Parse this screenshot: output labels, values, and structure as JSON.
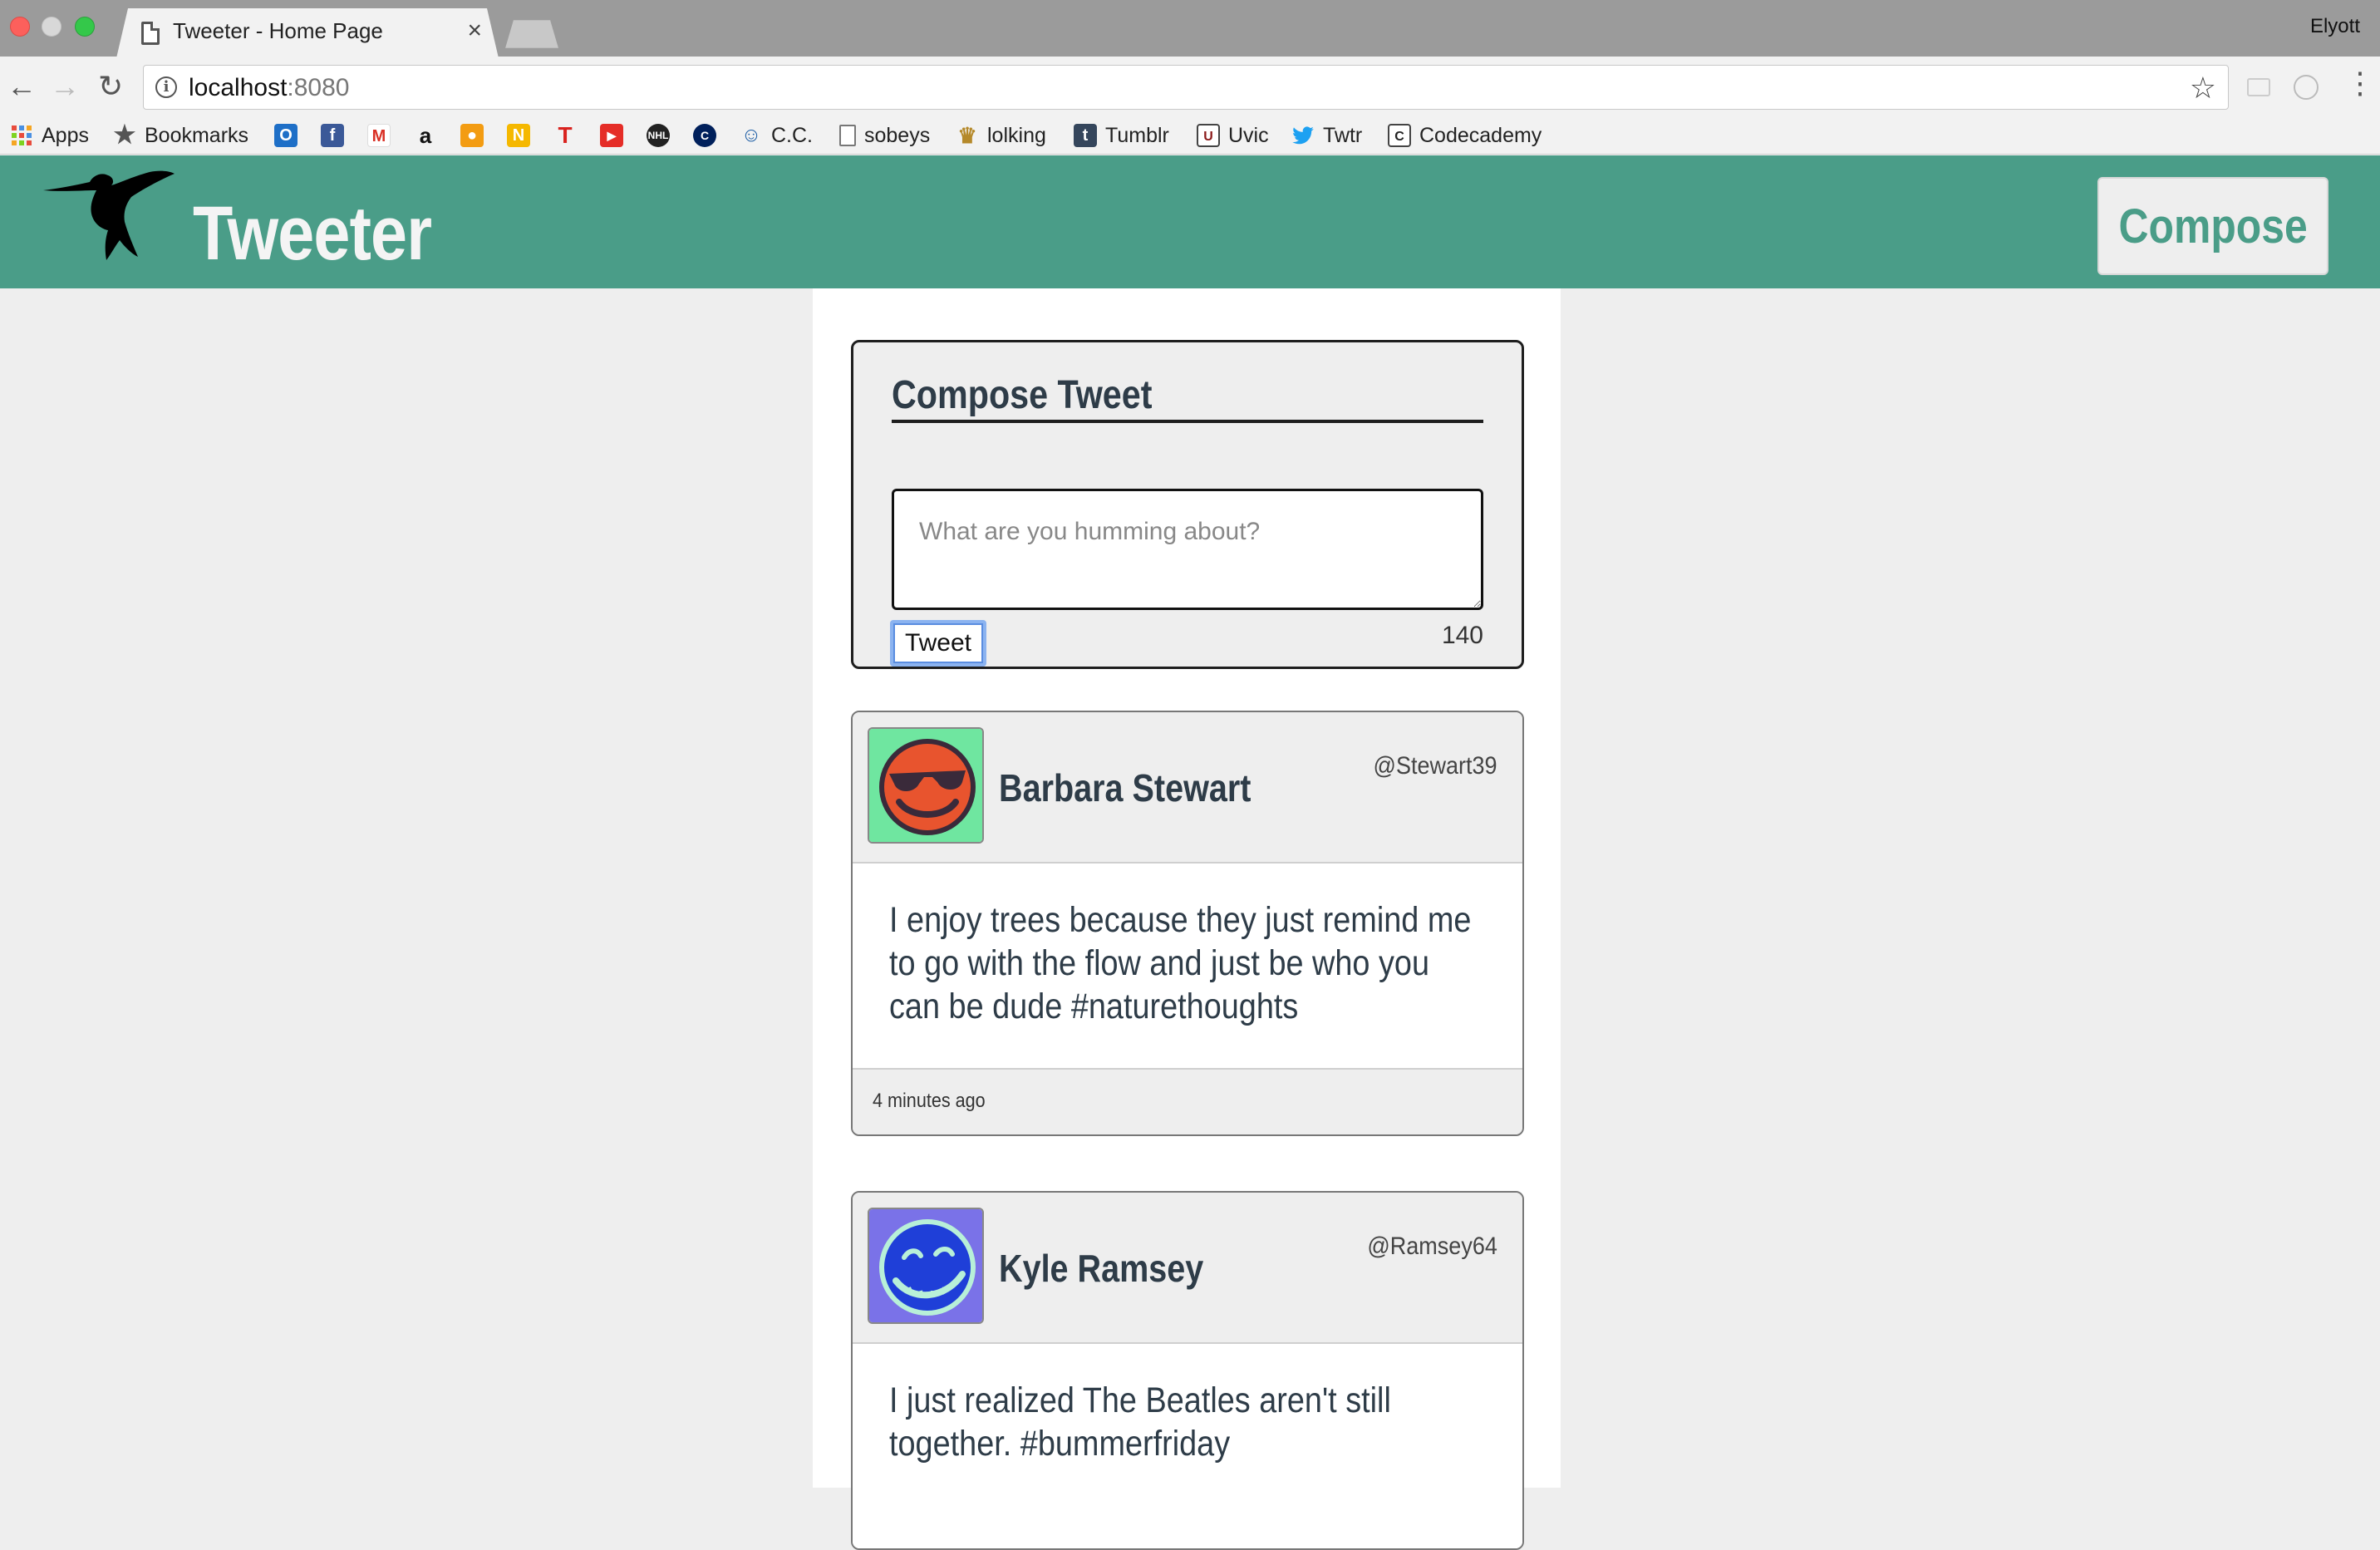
{
  "browser": {
    "tab_title": "Tweeter - Home Page",
    "tab_close": "×",
    "profile_name": "Elyott",
    "url_host": "localhost",
    "url_port": ":8080",
    "bookmarks": [
      {
        "label": "Apps",
        "icon": "apps-grid-icon"
      },
      {
        "label": "Bookmarks",
        "icon": "star-icon"
      },
      {
        "label": "",
        "icon": "outlook-icon"
      },
      {
        "label": "",
        "icon": "facebook-icon"
      },
      {
        "label": "",
        "icon": "gmail-icon"
      },
      {
        "label": "",
        "icon": "amazon-icon"
      },
      {
        "label": "",
        "icon": "orange-app-icon"
      },
      {
        "label": "",
        "icon": "n-app-icon"
      },
      {
        "label": "",
        "icon": "t-app-icon"
      },
      {
        "label": "",
        "icon": "youtube-icon"
      },
      {
        "label": "",
        "icon": "nhl-icon"
      },
      {
        "label": "",
        "icon": "canucks-icon"
      },
      {
        "label": "C.C.",
        "icon": "cc-icon"
      },
      {
        "label": "sobeys",
        "icon": "page-icon"
      },
      {
        "label": "lolking",
        "icon": "crown-icon"
      },
      {
        "label": "Tumblr",
        "icon": "tumblr-icon"
      },
      {
        "label": "Uvic",
        "icon": "uvic-icon"
      },
      {
        "label": "Twtr",
        "icon": "twitter-bird-icon"
      },
      {
        "label": "Codecademy",
        "icon": "codecademy-icon"
      }
    ]
  },
  "app": {
    "brand": "Tweeter",
    "compose_button": "Compose",
    "colors": {
      "primary": "#4a9d88",
      "text": "#2e3c48",
      "background": "#eeeeee"
    }
  },
  "composer": {
    "heading": "Compose Tweet",
    "placeholder": "What are you humming about?",
    "submit_label": "Tweet",
    "char_count": "140"
  },
  "tweets": [
    {
      "name": "Barbara Stewart",
      "handle": "@Stewart39",
      "text": "I enjoy trees because they just remind me to go with the flow and just be who you can be dude #naturethoughts",
      "time": "4 minutes ago",
      "avatar": "sunglasses-smiley-avatar"
    },
    {
      "name": "Kyle Ramsey",
      "handle": "@Ramsey64",
      "text": "I just realized The Beatles aren't still together. #bummerfriday",
      "time": "",
      "avatar": "sleepy-smiley-avatar"
    }
  ]
}
